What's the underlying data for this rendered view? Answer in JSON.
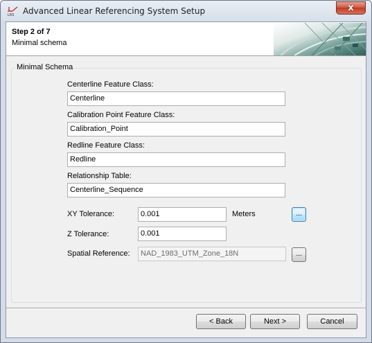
{
  "window": {
    "title": "Advanced Linear Referencing System Setup",
    "close_glyph": "x",
    "app_icon": "lrs-app-icon",
    "app_icon_text": "LRS"
  },
  "header": {
    "step": "Step 2 of 7",
    "subtitle": "Minimal schema"
  },
  "group": {
    "title": "Minimal Schema",
    "centerline": {
      "label": "Centerline Feature Class:",
      "value": "Centerline"
    },
    "calibration": {
      "label": "Calibration Point Feature Class:",
      "value": "Calibration_Point"
    },
    "redline": {
      "label": "Redline Feature Class:",
      "value": "Redline"
    },
    "relationship": {
      "label": "Relationship Table:",
      "value": "Centerline_Sequence"
    },
    "xy_tolerance": {
      "label": "XY Tolerance:",
      "value": "0.001",
      "units": "Meters",
      "browse": "..."
    },
    "z_tolerance": {
      "label": "Z Tolerance:",
      "value": "0.001"
    },
    "spatial_reference": {
      "label": "Spatial Reference:",
      "value": "NAD_1983_UTM_Zone_18N",
      "browse": "..."
    }
  },
  "footer": {
    "back": "< Back",
    "next": "Next >",
    "cancel": "Cancel"
  },
  "colors": {
    "accent": "#3c7fb1",
    "close": "#c13b26"
  }
}
